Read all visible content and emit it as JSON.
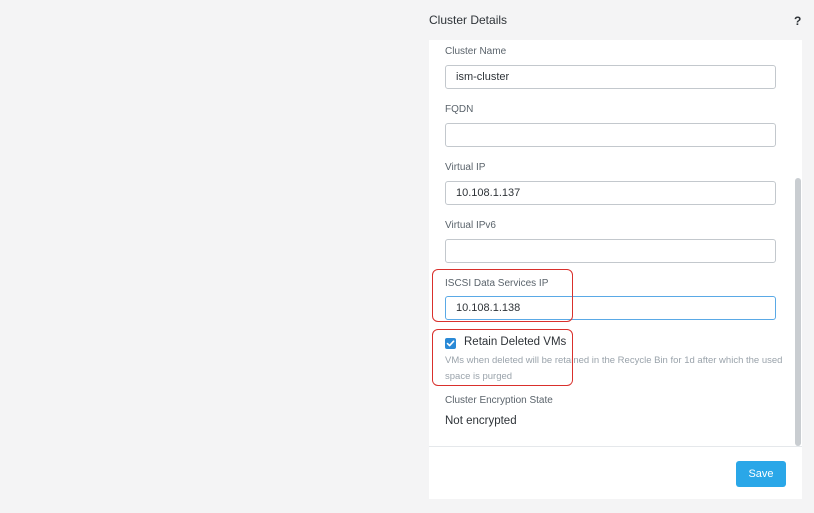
{
  "panel": {
    "title": "Cluster Details",
    "help_label": "?"
  },
  "form": {
    "cluster_name": {
      "label": "Cluster Name",
      "value": "ism-cluster"
    },
    "fqdn": {
      "label": "FQDN",
      "value": ""
    },
    "virtual_ip": {
      "label": "Virtual IP",
      "value": "10.108.1.137"
    },
    "virtual_ipv6": {
      "label": "Virtual IPv6",
      "value": ""
    },
    "iscsi_ip": {
      "label": "ISCSI Data Services IP",
      "value": "10.108.1.138"
    },
    "retain_deleted_vms": {
      "label": "Retain Deleted VMs",
      "checked": true,
      "help": "VMs when deleted will be retained in the Recycle Bin for 1d after which the used space is purged"
    },
    "encryption": {
      "label": "Cluster Encryption State",
      "value": "Not encrypted"
    }
  },
  "footer": {
    "save_label": "Save"
  },
  "colors": {
    "accent": "#2aa7e8",
    "checkbox": "#2a89d6",
    "highlight": "#d9302c"
  }
}
